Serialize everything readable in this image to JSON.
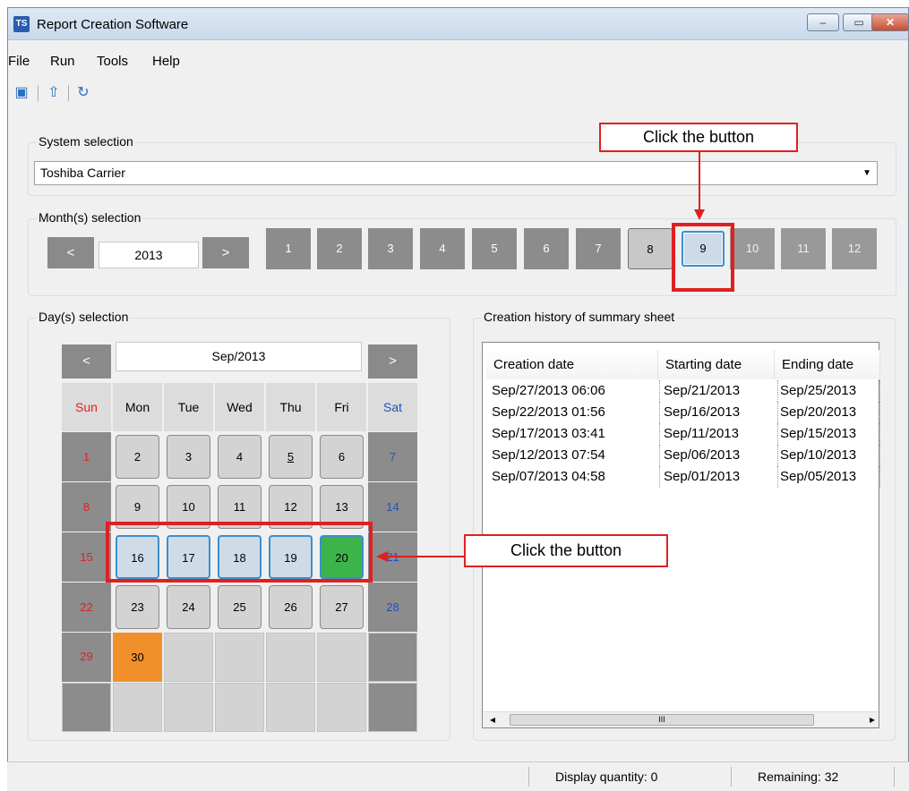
{
  "window": {
    "title": "Report Creation Software",
    "app_icon": "TS",
    "min": "–",
    "max": "▭",
    "close": "✕"
  },
  "menu": [
    {
      "label": "File"
    },
    {
      "label": "Run"
    },
    {
      "label": "Tools"
    },
    {
      "label": "Help"
    }
  ],
  "toolbar": {
    "icons": [
      "report-icon",
      "export-icon",
      "refresh-icon"
    ]
  },
  "system": {
    "legend": "System selection",
    "value": "Toshiba Carrier"
  },
  "months": {
    "legend": "Month(s) selection",
    "prev": "<",
    "next": ">",
    "year": "2013",
    "items": [
      "1",
      "2",
      "3",
      "4",
      "5",
      "6",
      "7",
      "8",
      "9",
      "10",
      "11",
      "12"
    ],
    "selected": "8",
    "current": "9"
  },
  "days": {
    "legend": "Day(s) selection",
    "prev": "<",
    "next": ">",
    "month_label": "Sep/2013",
    "dow": [
      "Sun",
      "Mon",
      "Tue",
      "Wed",
      "Thu",
      "Fri",
      "Sat"
    ],
    "colors": {
      "sun": "#e02020",
      "sat": "#2050c0",
      "today": "#f0902a",
      "selected": "#3cb44a"
    }
  },
  "history": {
    "legend": "Creation history of summary sheet",
    "columns": [
      "Creation date",
      "Starting date",
      "Ending date"
    ],
    "rows": [
      [
        "Sep/27/2013 06:06",
        "Sep/21/2013",
        "Sep/25/2013"
      ],
      [
        "Sep/22/2013 01:56",
        "Sep/16/2013",
        "Sep/20/2013"
      ],
      [
        "Sep/17/2013 03:41",
        "Sep/11/2013",
        "Sep/15/2013"
      ],
      [
        "Sep/12/2013 07:54",
        "Sep/06/2013",
        "Sep/10/2013"
      ],
      [
        "Sep/07/2013 04:58",
        "Sep/01/2013",
        "Sep/05/2013"
      ]
    ],
    "scroll_left": "◂",
    "scroll_right": "▸",
    "scroll_grip": "III"
  },
  "status": {
    "display": "Display quantity: 0",
    "remaining": "Remaining: 32"
  },
  "annotations": {
    "top": "Click the button",
    "middle": "Click the button"
  }
}
